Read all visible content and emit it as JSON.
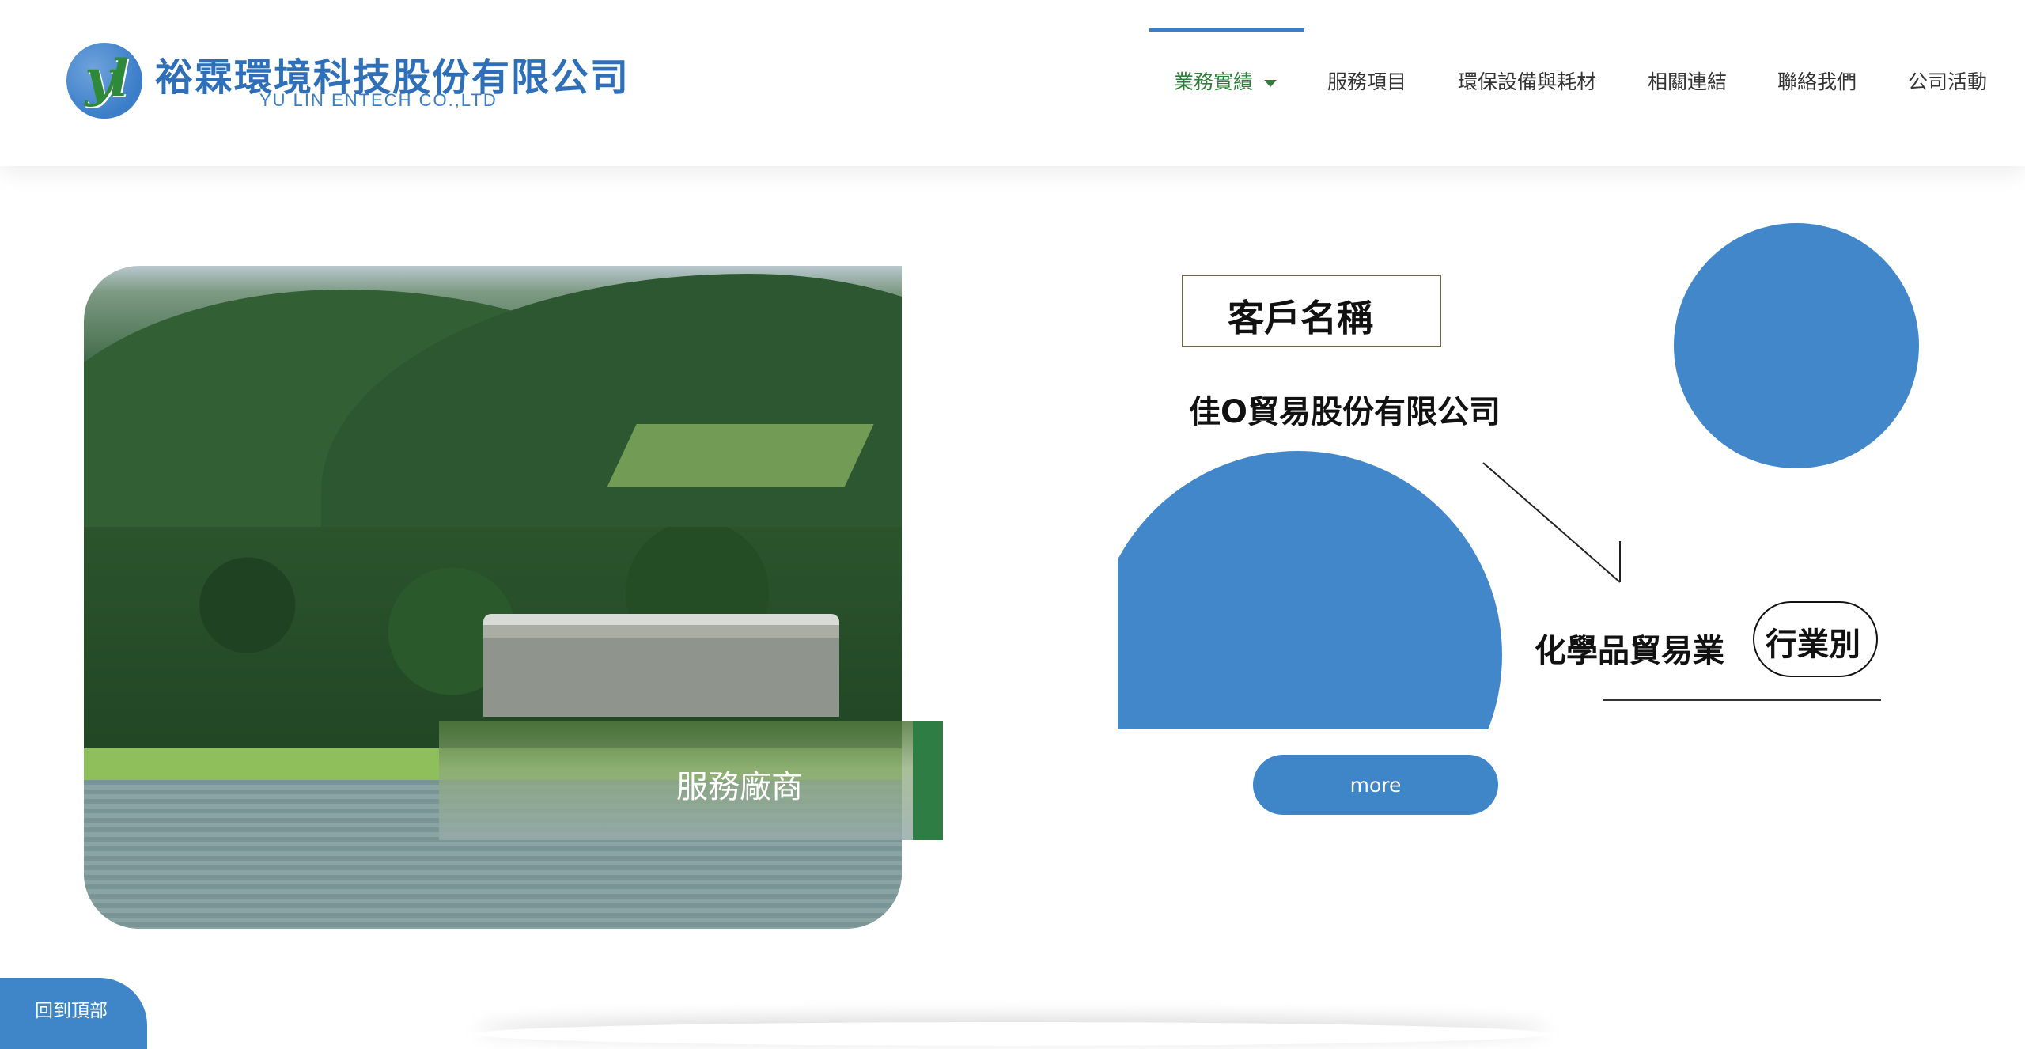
{
  "brand": {
    "logo_mark": "yl",
    "title": "裕霖環境科技股份有限公司",
    "subtitle": "YU LIN ENTECH CO.,LTD"
  },
  "nav": {
    "items": [
      {
        "label": "業務實績",
        "active": true,
        "has_dropdown": true
      },
      {
        "label": "服務項目"
      },
      {
        "label": "環保設備與耗材"
      },
      {
        "label": "相關連結"
      },
      {
        "label": "聯絡我們"
      },
      {
        "label": "公司活動"
      }
    ]
  },
  "hero": {
    "vendor_label": "服務廠商"
  },
  "customer": {
    "heading": "客戶名稱",
    "name": "佳O貿易股份有限公司",
    "industry": "化學品貿易業",
    "industry_tag": "行業別",
    "more_label": "more"
  },
  "footer": {
    "back_to_top": "回到頂部"
  },
  "colors": {
    "accent_blue": "#4287c9",
    "accent_green": "#2e7d45",
    "nav_active": "#2e7d3a"
  }
}
